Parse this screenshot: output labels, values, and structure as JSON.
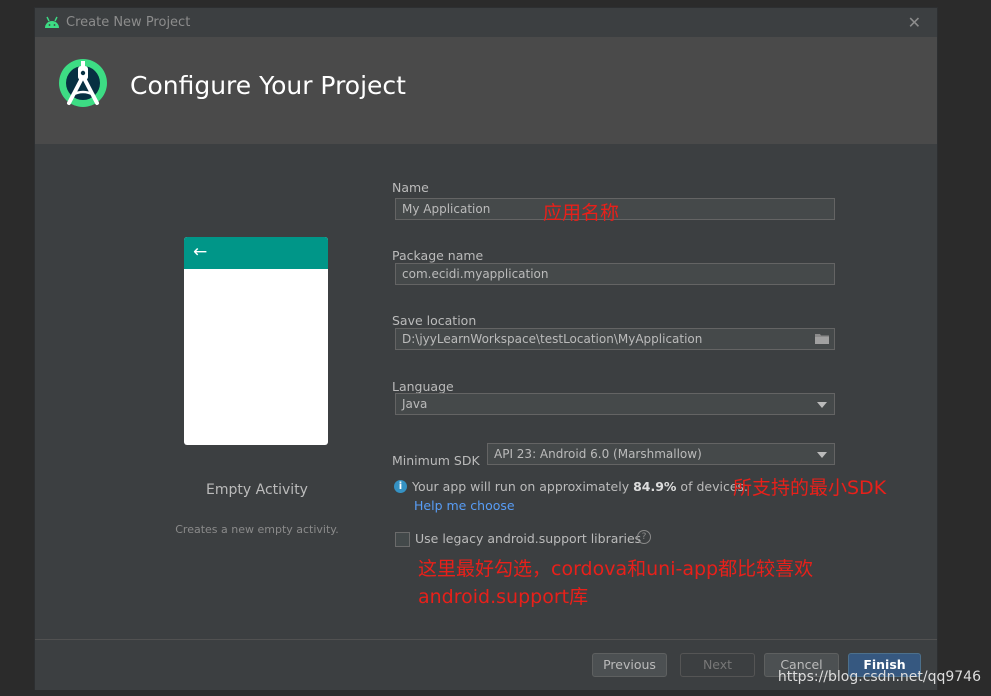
{
  "window": {
    "title": "Create New Project",
    "close_glyph": "✕"
  },
  "header": {
    "title": "Configure Your Project"
  },
  "template": {
    "name": "Empty Activity",
    "description": "Creates a new empty activity."
  },
  "form": {
    "name_label": "Name",
    "name_value": "My Application",
    "package_label": "Package name",
    "package_value": "com.ecidi.myapplication",
    "location_label": "Save location",
    "location_value": "D:\\jyyLearnWorkspace\\testLocation\\MyApplication",
    "language_label": "Language",
    "language_value": "Java",
    "min_sdk_label": "Minimum SDK",
    "min_sdk_value": "API 23: Android 6.0 (Marshmallow)",
    "info_prefix": "Your app will run on approximately ",
    "info_percent": "84.9%",
    "info_suffix": " of devices.",
    "help_link": "Help me choose",
    "legacy_label": "Use legacy android.support libraries",
    "legacy_checked": false
  },
  "annotations": {
    "app_name": "应用名称",
    "min_sdk": "所支持的最小SDK",
    "legacy_line1": "这里最好勾选，cordova和uni-app都比较喜欢",
    "legacy_line2": "android.support库"
  },
  "footer": {
    "previous": "Previous",
    "next": "Next",
    "cancel": "Cancel",
    "finish": "Finish"
  },
  "watermark": "https://blog.csdn.net/qq9746",
  "colors": {
    "accent": "#365880",
    "link": "#589df6",
    "annotation": "#e8201a",
    "toolbar_teal": "#009688",
    "android_green": "#3ddc84"
  },
  "icons": [
    "android-icon",
    "android-studio-logo",
    "close-icon",
    "back-arrow-icon",
    "folder-icon",
    "info-icon",
    "help-icon",
    "chevron-down-icon"
  ]
}
